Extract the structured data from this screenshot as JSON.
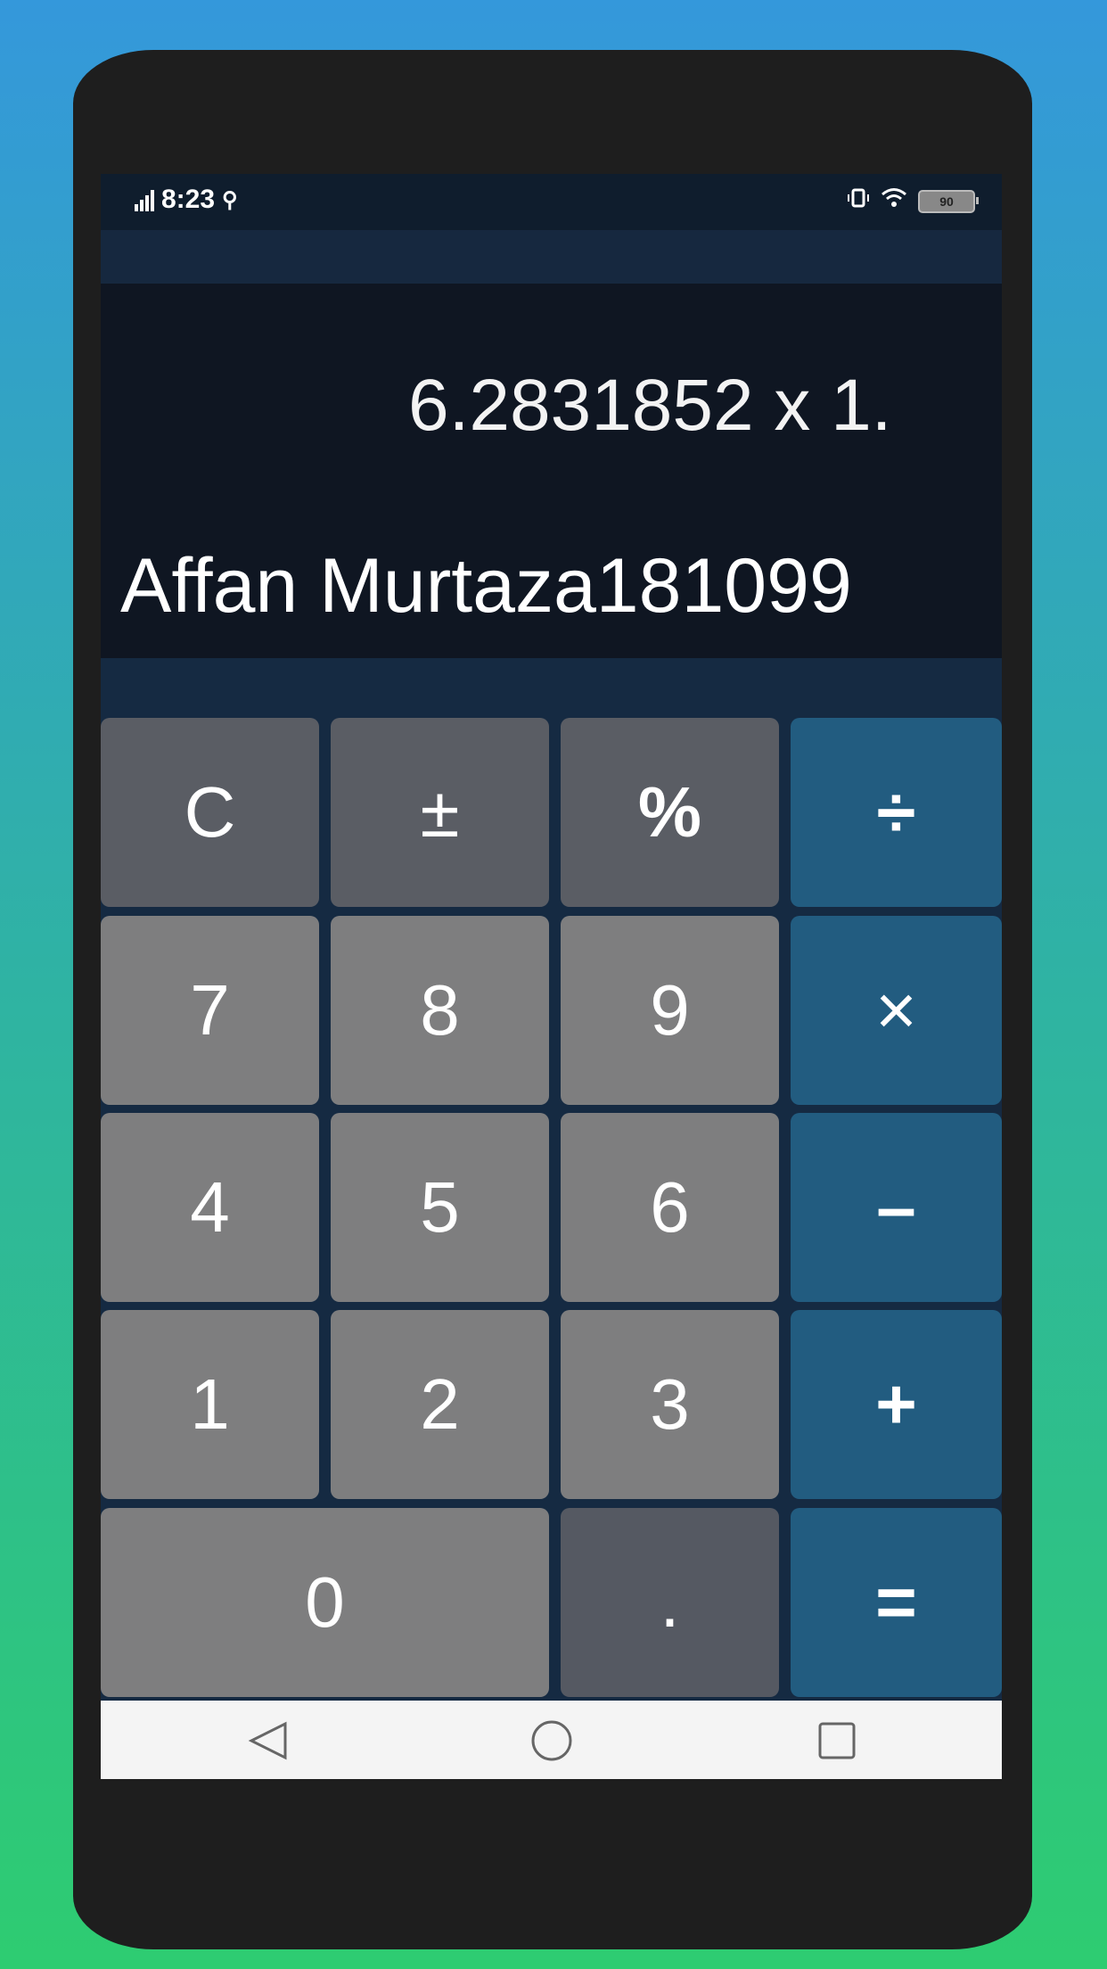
{
  "status_bar": {
    "time": "8:23",
    "battery": "90"
  },
  "display": {
    "expression": "6.2831852 x 1.",
    "result": "Affan Murtaza181099"
  },
  "keys": {
    "clear": "C",
    "sign": "±",
    "percent": "%",
    "divide": "÷",
    "seven": "7",
    "eight": "8",
    "nine": "9",
    "multiply": "×",
    "four": "4",
    "five": "5",
    "six": "6",
    "subtract": "–",
    "one": "1",
    "two": "2",
    "three": "3",
    "add": "+",
    "zero": "0",
    "decimal": ".",
    "equals": "="
  },
  "colors": {
    "function_key": "#5a5d64",
    "number_key": "#7e7e7f",
    "operator_key": "#225c80",
    "display_bg": "#0f1622"
  },
  "nav_bar": {
    "back_icon": "back-triangle-icon",
    "home_icon": "home-circle-icon",
    "recents_icon": "recents-square-icon"
  }
}
